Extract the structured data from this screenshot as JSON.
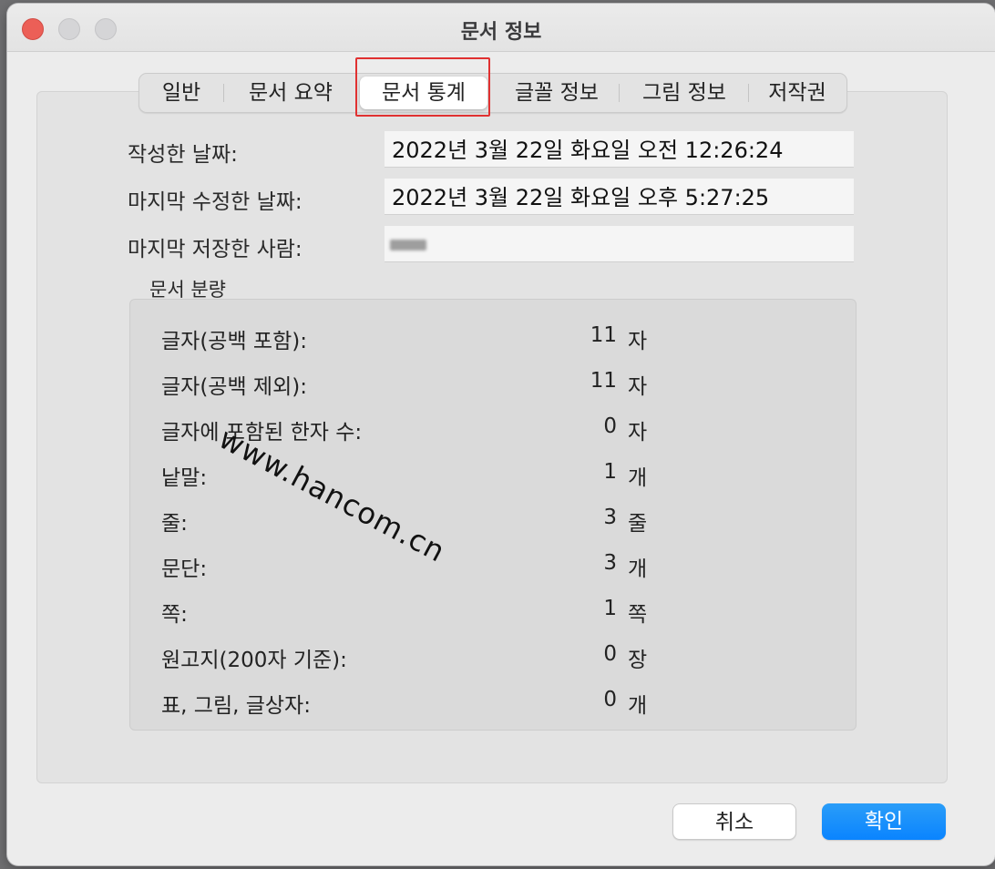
{
  "window": {
    "title": "문서 정보"
  },
  "tabs": [
    {
      "label": "일반"
    },
    {
      "label": "문서 요약"
    },
    {
      "label": "문서 통계"
    },
    {
      "label": "글꼴 정보"
    },
    {
      "label": "그림 정보"
    },
    {
      "label": "저작권"
    }
  ],
  "active_tab": "문서 통계",
  "fields": {
    "created": {
      "label": "작성한 날짜:",
      "value": "2022년 3월 22일 화요일 오전 12:26:24"
    },
    "modified": {
      "label": "마지막 수정한 날짜:",
      "value": "2022년 3월 22일 화요일 오후 5:27:25"
    },
    "saved_by": {
      "label": "마지막 저장한 사람:",
      "value": ""
    }
  },
  "stats": {
    "group_label": "문서 분량",
    "rows": [
      {
        "label": "글자(공백 포함):",
        "value": "11",
        "unit": "자"
      },
      {
        "label": "글자(공백 제외):",
        "value": "11",
        "unit": "자"
      },
      {
        "label": "글자에 포함된 한자 수:",
        "value": "0",
        "unit": "자"
      },
      {
        "label": "낱말:",
        "value": "1",
        "unit": "개"
      },
      {
        "label": "줄:",
        "value": "3",
        "unit": "줄"
      },
      {
        "label": "문단:",
        "value": "3",
        "unit": "개"
      },
      {
        "label": "쪽:",
        "value": "1",
        "unit": "쪽"
      },
      {
        "label": "원고지(200자 기준):",
        "value": "0",
        "unit": "장"
      },
      {
        "label": "표, 그림, 글상자:",
        "value": "0",
        "unit": "개"
      }
    ]
  },
  "watermark": "www.hancom.cn",
  "buttons": {
    "cancel": "취소",
    "ok": "확인"
  },
  "colors": {
    "accent": "#0a84ff",
    "highlight": "#e03131",
    "close": "#ec5f57"
  }
}
